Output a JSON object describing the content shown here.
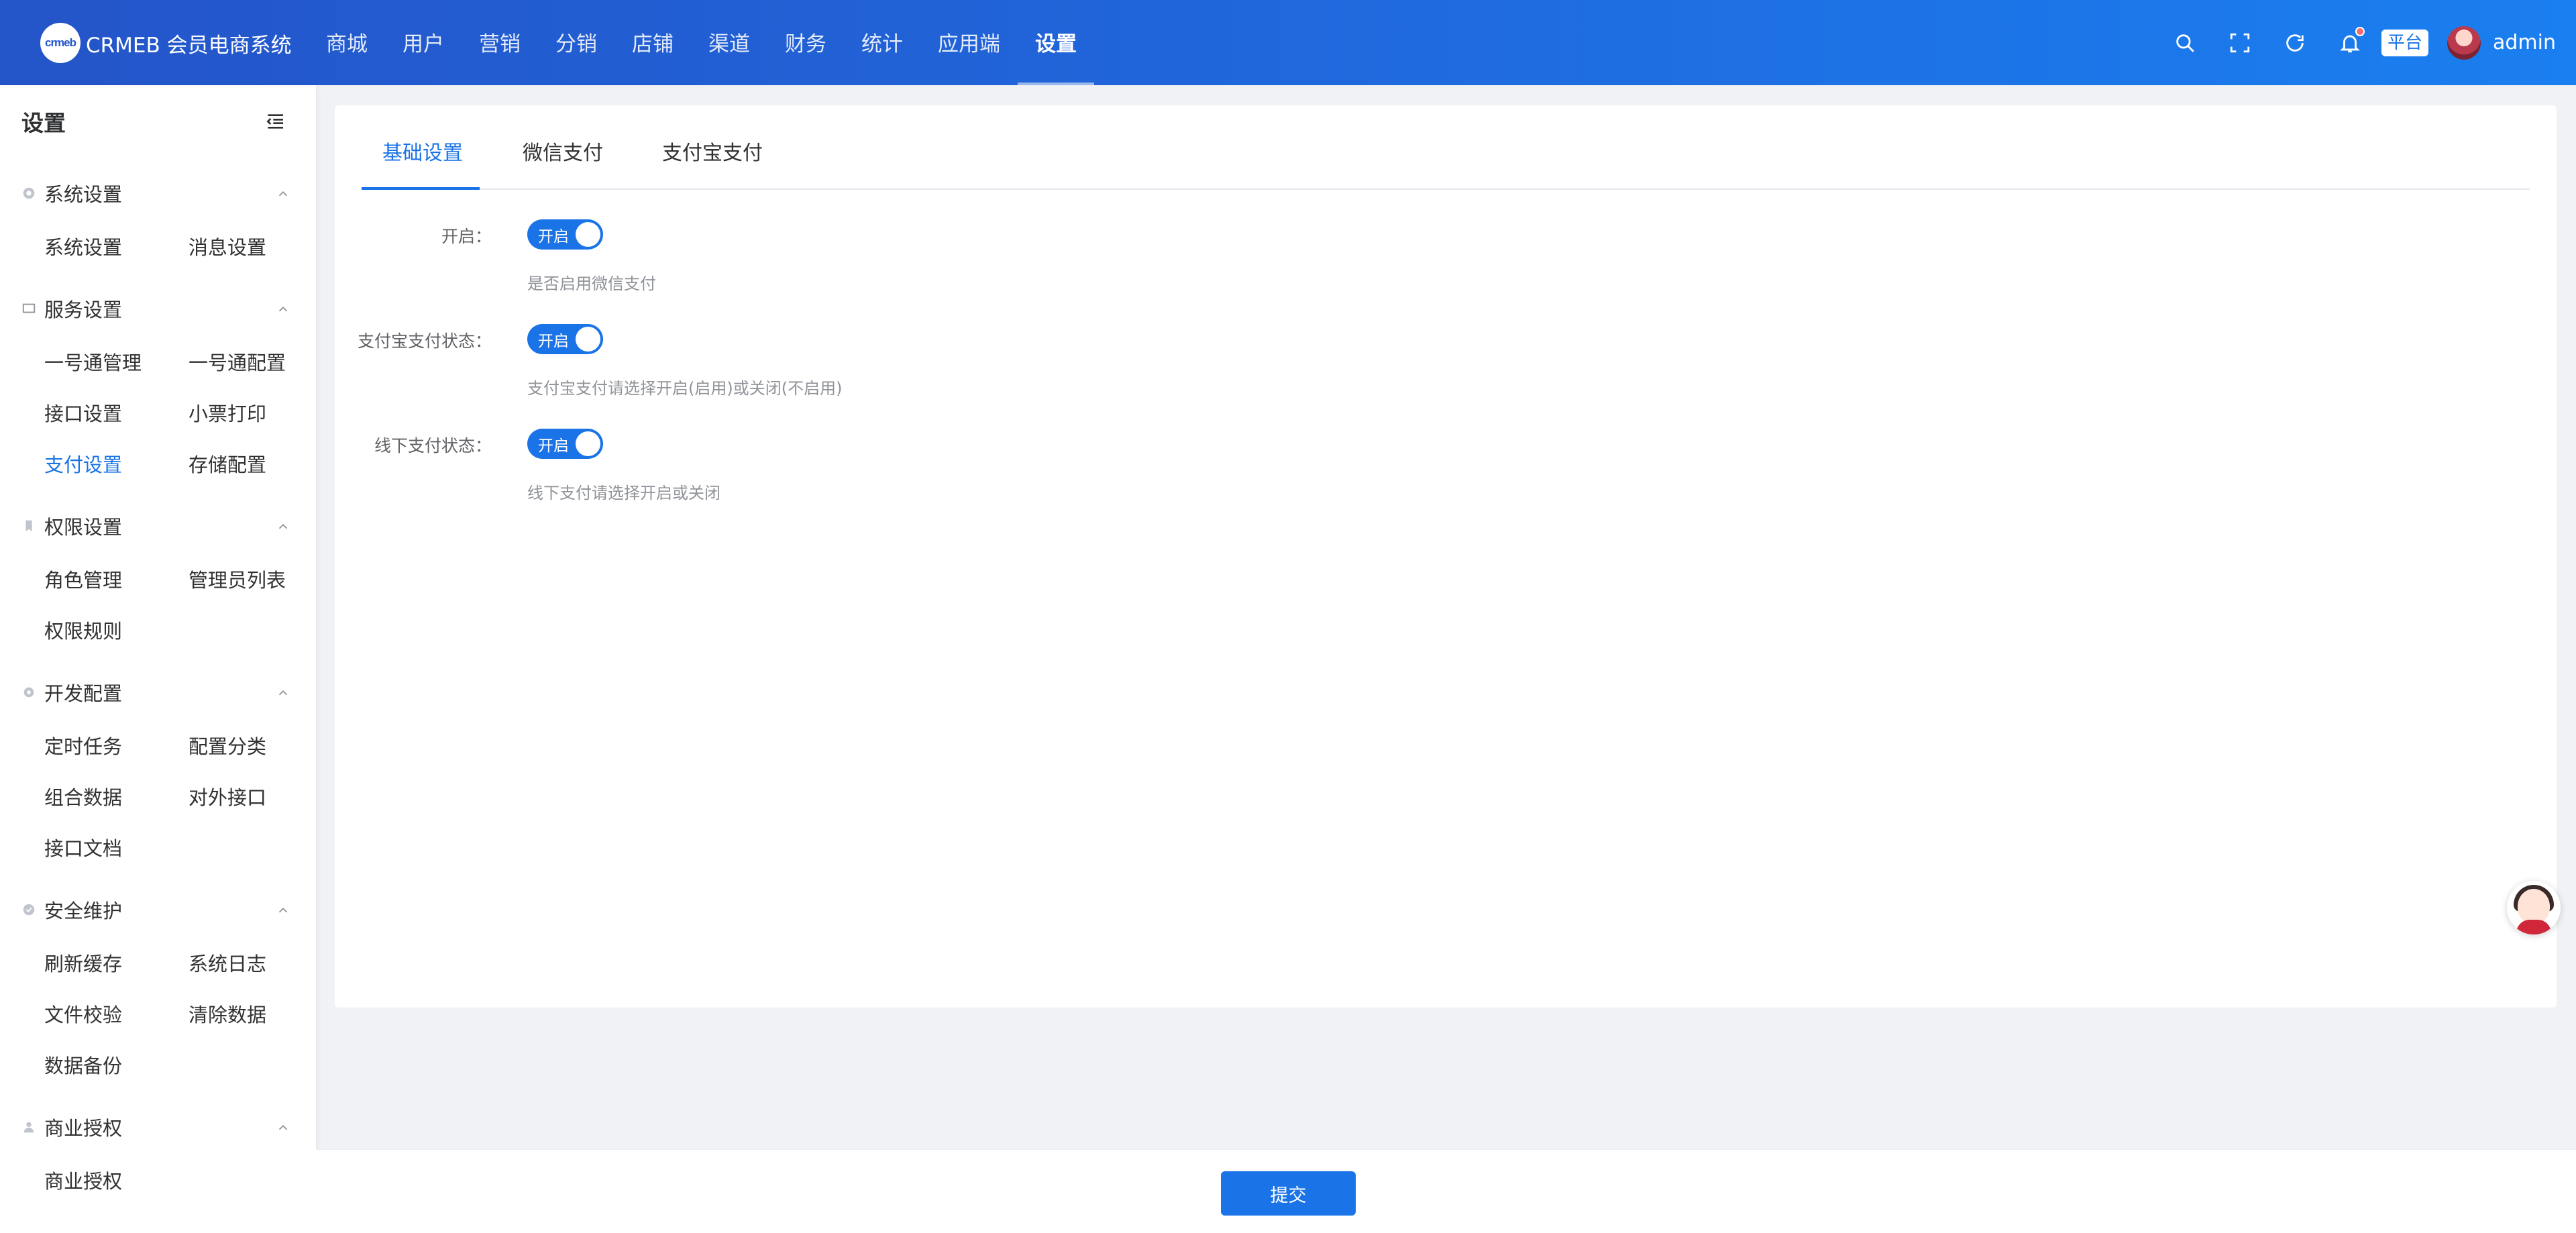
{
  "app": {
    "logo_mark": "crmeb",
    "logo_text": "CRMEB 会员电商系统"
  },
  "nav": [
    {
      "label": "商城"
    },
    {
      "label": "用户"
    },
    {
      "label": "营销"
    },
    {
      "label": "分销"
    },
    {
      "label": "店铺"
    },
    {
      "label": "渠道"
    },
    {
      "label": "财务"
    },
    {
      "label": "统计"
    },
    {
      "label": "应用端"
    },
    {
      "label": "设置",
      "active": true
    }
  ],
  "header": {
    "platform_tag": "平台",
    "username": "admin",
    "notification_dot": true
  },
  "sidebar": {
    "title": "设置",
    "groups": [
      {
        "label": "系统设置",
        "icon": "gear-icon",
        "items": [
          "系统设置",
          "消息设置"
        ]
      },
      {
        "label": "服务设置",
        "icon": "monitor-icon",
        "items": [
          "一号通管理",
          "一号通配置",
          "接口设置",
          "小票打印",
          "支付设置",
          "存储配置"
        ]
      },
      {
        "label": "权限设置",
        "icon": "bookmark-icon",
        "items": [
          "角色管理",
          "管理员列表",
          "权限规则"
        ]
      },
      {
        "label": "开发配置",
        "icon": "cog-icon",
        "items": [
          "定时任务",
          "配置分类",
          "组合数据",
          "对外接口",
          "接口文档"
        ]
      },
      {
        "label": "安全维护",
        "icon": "check-circle-icon",
        "items": [
          "刷新缓存",
          "系统日志",
          "文件校验",
          "清除数据",
          "数据备份"
        ]
      },
      {
        "label": "商业授权",
        "icon": "user-icon",
        "items": [
          "商业授权"
        ]
      }
    ],
    "active_item": "支付设置"
  },
  "tabs": [
    {
      "label": "基础设置",
      "active": true
    },
    {
      "label": "微信支付"
    },
    {
      "label": "支付宝支付"
    }
  ],
  "form": {
    "fields": [
      {
        "label": "开启：",
        "switch_text": "开启",
        "value": true,
        "hint": "是否启用微信支付"
      },
      {
        "label": "支付宝支付状态：",
        "switch_text": "开启",
        "value": true,
        "hint": "支付宝支付请选择开启(启用)或关闭(不启用)"
      },
      {
        "label": "线下支付状态：",
        "switch_text": "开启",
        "value": true,
        "hint": "线下支付请选择开启或关闭"
      }
    ],
    "submit_label": "提交"
  },
  "watermark": "crmeb",
  "colors": {
    "primary": "#1a74e8",
    "header_start": "#2455c9",
    "header_end": "#1a7ff0"
  }
}
